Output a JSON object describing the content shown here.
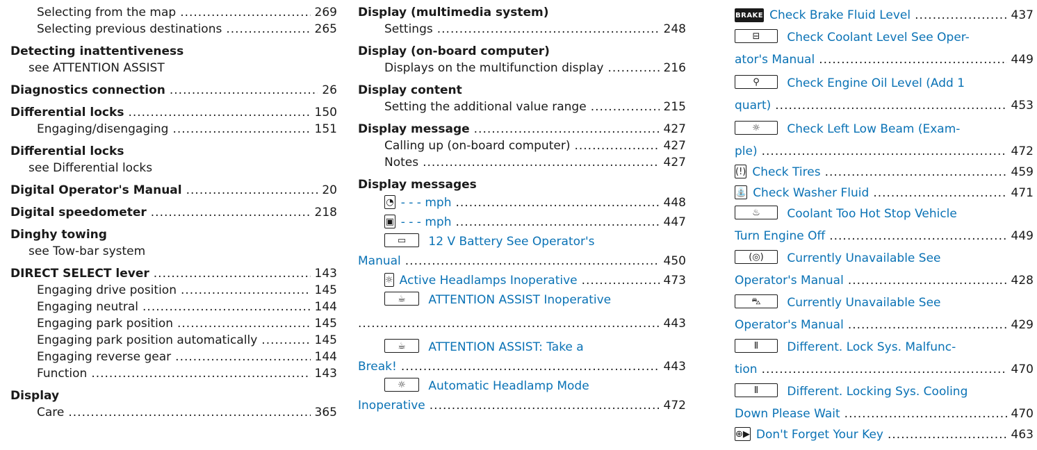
{
  "col1": {
    "r0": {
      "label": "Selecting from the map",
      "page": "269"
    },
    "r1": {
      "label": "Selecting previous destinations",
      "page": "265"
    },
    "r2": {
      "label": "Detecting inattentiveness"
    },
    "r3": {
      "label": "see ATTENTION ASSIST"
    },
    "r4": {
      "label": "Diagnostics connection",
      "page": "26"
    },
    "r5": {
      "label": "Differential locks",
      "page": "150"
    },
    "r6": {
      "label": "Engaging/disengaging",
      "page": "151"
    },
    "r7": {
      "label": "Differential locks"
    },
    "r8": {
      "label": "see Differential locks"
    },
    "r9": {
      "label": "Digital Operator's Manual",
      "page": "20"
    },
    "r10": {
      "label": "Digital speedometer",
      "page": "218"
    },
    "r11": {
      "label": "Dinghy towing"
    },
    "r12": {
      "label": "see Tow-bar system"
    },
    "r13": {
      "label": "DIRECT SELECT lever",
      "page": "143"
    },
    "r14": {
      "label": "Engaging drive position",
      "page": "145"
    },
    "r15": {
      "label": "Engaging neutral",
      "page": "144"
    },
    "r16": {
      "label": "Engaging park position",
      "page": "145"
    },
    "r17": {
      "label": "Engaging park position automatically",
      "page": "145"
    },
    "r18": {
      "label": "Engaging reverse gear",
      "page": "144"
    },
    "r19": {
      "label": "Function",
      "page": "143"
    },
    "r20": {
      "label": "Display"
    },
    "r21": {
      "label": "Care",
      "page": "365"
    }
  },
  "col2": {
    "h0": {
      "label": "Display (multimedia system)"
    },
    "s0": {
      "label": "Settings",
      "page": "248"
    },
    "h1": {
      "label": "Display (on-board computer)"
    },
    "s1": {
      "label": "Displays on the multifunction display",
      "page": "216"
    },
    "h2": {
      "label": "Display content"
    },
    "s2": {
      "label": "Setting the additional value range",
      "page": "215"
    },
    "h3": {
      "label": "Display message",
      "page": "427"
    },
    "s3": {
      "label": "Calling up (on-board computer)",
      "page": "427"
    },
    "s4": {
      "label": "Notes",
      "page": "427"
    },
    "h4": {
      "label": "Display messages"
    },
    "m0": {
      "label": "- - - mph",
      "page": "448",
      "icon": "speedometer-icon",
      "glyph": "◔"
    },
    "m1": {
      "label": "- - - mph",
      "page": "447",
      "icon": "speedometer-off-icon",
      "glyph": "▣"
    },
    "m2a": {
      "label": "12 V Battery See Operator's",
      "icon": "battery-icon",
      "glyph": "▭"
    },
    "m2b": {
      "label": "Manual",
      "page": "450"
    },
    "m3": {
      "label": "Active Headlamps Inoperative",
      "page": "473",
      "icon": "headlamp-icon",
      "glyph": "☼"
    },
    "m4a": {
      "label": "ATTENTION ASSIST Inoperative",
      "icon": "coffee-cup-icon",
      "glyph": "☕"
    },
    "m4b": {
      "page": "443"
    },
    "m5a": {
      "label": "ATTENTION ASSIST: Take a",
      "icon": "coffee-cup-icon",
      "glyph": "☕"
    },
    "m5b": {
      "label": "Break!",
      "page": "443"
    },
    "m6a": {
      "label": "Automatic Headlamp Mode",
      "icon": "headlamp-icon",
      "glyph": "☼"
    },
    "m6b": {
      "label": "Inoperative",
      "page": "472"
    }
  },
  "col3": {
    "m0": {
      "label": "Check Brake Fluid Level",
      "page": "437",
      "icon": "brake-icon",
      "glyph": "BRAKE"
    },
    "m1a": {
      "label": "Check Coolant Level See Oper-",
      "icon": "coolant-reservoir-icon",
      "glyph": "⊟"
    },
    "m1b": {
      "label": "ator's Manual",
      "page": "449"
    },
    "m2a": {
      "label": "Check Engine Oil Level (Add 1",
      "icon": "oil-can-icon",
      "glyph": "⚲"
    },
    "m2b": {
      "label": "quart)",
      "page": "453"
    },
    "m3a": {
      "label": "Check Left Low Beam (Exam-",
      "icon": "headlamp-icon",
      "glyph": "☼"
    },
    "m3b": {
      "label": "ple)",
      "page": "472"
    },
    "m4": {
      "label": "Check Tires",
      "page": "459",
      "icon": "tire-pressure-icon",
      "glyph": "(!)"
    },
    "m5": {
      "label": "Check Washer Fluid",
      "page": "471",
      "icon": "washer-fluid-icon",
      "glyph": "⛲"
    },
    "m6a": {
      "label": "Coolant Too Hot Stop Vehicle",
      "icon": "coolant-temp-icon",
      "glyph": "♨"
    },
    "m6b": {
      "label": "Turn Engine Off",
      "page": "449"
    },
    "m7a": {
      "label": "Currently Unavailable See",
      "icon": "abs-icon",
      "glyph": "(◎)"
    },
    "m7b": {
      "label": "Operator's Manual",
      "page": "428"
    },
    "m8a": {
      "label": "Currently Unavailable See",
      "icon": "skid-icon",
      "glyph": "⛍"
    },
    "m8b": {
      "label": "Operator's Manual",
      "page": "429"
    },
    "m9a": {
      "label": "Different. Lock Sys. Malfunc-",
      "icon": "diff-lock-icon",
      "glyph": "Ⅱ"
    },
    "m9b": {
      "label": "tion",
      "page": "470"
    },
    "m10a": {
      "label": "Different. Locking Sys. Cooling",
      "icon": "diff-lock-icon",
      "glyph": "Ⅱ"
    },
    "m10b": {
      "label": "Down Please Wait",
      "page": "470"
    },
    "m11": {
      "label": "Don't Forget Your Key",
      "page": "463",
      "icon": "key-icon",
      "glyph": "⊕▶"
    }
  }
}
